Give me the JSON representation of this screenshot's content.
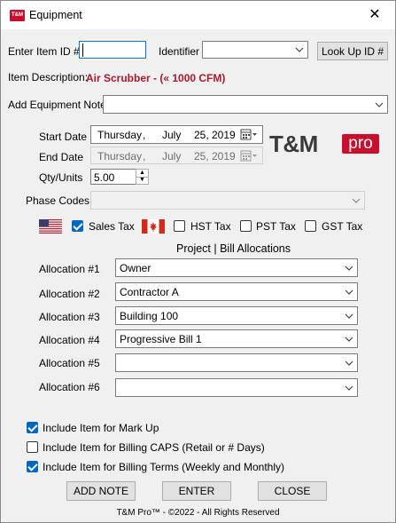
{
  "window": {
    "title": "Equipment",
    "app_icon_text": "T&M",
    "close_glyph": "✕"
  },
  "item_id": {
    "label": "Enter Item ID #",
    "value": ""
  },
  "identifier": {
    "label": "Identifier",
    "value": ""
  },
  "lookup_button": "Look Up ID #",
  "description": {
    "label": "Item Description:",
    "value": "Air Scrubber - (« 1000 CFM)"
  },
  "note": {
    "label": "Add Equipment Note",
    "value": ""
  },
  "start_date": {
    "label": "Start Date",
    "weekday": "Thursday",
    "month": "July",
    "day": "25,",
    "year": "2019"
  },
  "end_date": {
    "label": "End Date",
    "weekday": "Thursday",
    "month": "July",
    "day": "25,",
    "year": "2019"
  },
  "qty": {
    "label": "Qty/Units",
    "value": "5.00"
  },
  "phase": {
    "label": "Phase Codes",
    "value": ""
  },
  "logo": {
    "text_tm": "T&M",
    "text_pro": "pro"
  },
  "taxes": {
    "sales": {
      "label": "Sales Tax",
      "checked": true
    },
    "hst": {
      "label": "HST Tax",
      "checked": false
    },
    "pst": {
      "label": "PST Tax",
      "checked": false
    },
    "gst": {
      "label": "GST Tax",
      "checked": false
    }
  },
  "allocations": {
    "heading": "Project | Bill Allocations",
    "items": [
      {
        "label": "Allocation #1",
        "value": "Owner"
      },
      {
        "label": "Allocation #2",
        "value": "Contractor A"
      },
      {
        "label": "Allocation #3",
        "value": "Building 100"
      },
      {
        "label": "Allocation #4",
        "value": "Progressive Bill 1"
      },
      {
        "label": "Allocation #5",
        "value": ""
      },
      {
        "label": "Allocation #6",
        "value": ""
      }
    ]
  },
  "options": {
    "markup": {
      "label": "Include Item for Mark Up",
      "checked": true
    },
    "caps": {
      "label": "Include Item for Billing CAPS (Retail or # Days)",
      "checked": false
    },
    "terms": {
      "label": "Include Item for Billing Terms (Weekly and Monthly)",
      "checked": true
    }
  },
  "buttons": {
    "add_note": "ADD NOTE",
    "enter": "ENTER",
    "close": "CLOSE"
  },
  "footer": "T&M Pro™ - ©2022 - All Rights Reserved",
  "colors": {
    "brand_red": "#c8102e",
    "description_red": "#a6192e",
    "check_blue": "#0067c0",
    "focus_blue": "#0078d7"
  }
}
